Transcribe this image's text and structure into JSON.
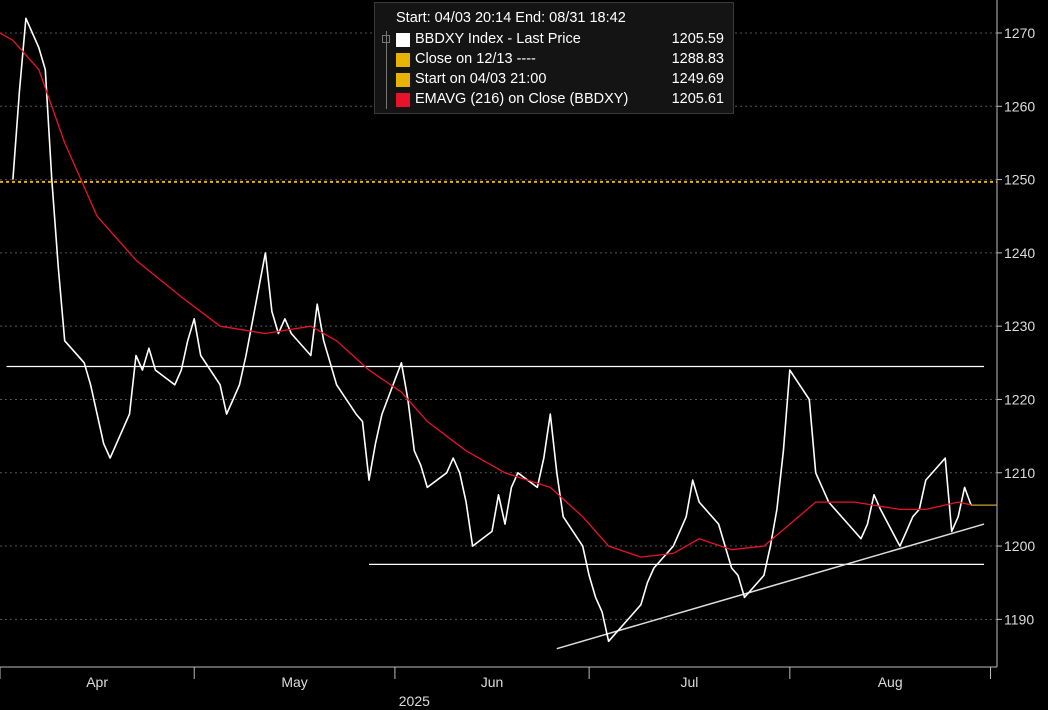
{
  "legend": {
    "header": "Start: 04/03 20:14  End: 08/31 18:42",
    "items": [
      {
        "label": "BBDXY Index - Last Price",
        "value": "1205.59",
        "color": "#ffffff"
      },
      {
        "label": "Close on 12/13 ----",
        "value": "1288.83",
        "color": "#e8b200"
      },
      {
        "label": "Start on 04/03 21:00",
        "value": "1249.69",
        "color": "#e8b200"
      },
      {
        "label": "EMAVG (216)  on Close (BBDXY)",
        "value": "1205.61",
        "color": "#e8132a"
      }
    ]
  },
  "chart_data": {
    "type": "line",
    "title": "",
    "xlabel": "2025",
    "ylabel": "",
    "x_ticks": [
      "Apr",
      "May",
      "Jun",
      "Jul",
      "Aug"
    ],
    "y_ticks": [
      1190,
      1200,
      1210,
      1220,
      1230,
      1240,
      1250,
      1260,
      1270
    ],
    "ylim": [
      1183.5,
      1274.5
    ],
    "grid": "horizontal dashed",
    "series": [
      {
        "name": "BBDXY Index - Last Price",
        "color": "#ffffff",
        "points": [
          [
            "04/03",
            1250
          ],
          [
            "04/04",
            1262
          ],
          [
            "04/05",
            1272
          ],
          [
            "04/07",
            1268
          ],
          [
            "04/08",
            1265
          ],
          [
            "04/09",
            1250
          ],
          [
            "04/10",
            1238
          ],
          [
            "04/11",
            1228
          ],
          [
            "04/14",
            1225
          ],
          [
            "04/15",
            1222
          ],
          [
            "04/16",
            1218
          ],
          [
            "04/17",
            1214
          ],
          [
            "04/18",
            1212
          ],
          [
            "04/21",
            1218
          ],
          [
            "04/22",
            1226
          ],
          [
            "04/23",
            1224
          ],
          [
            "04/24",
            1227
          ],
          [
            "04/25",
            1224
          ],
          [
            "04/28",
            1222
          ],
          [
            "04/29",
            1224
          ],
          [
            "04/30",
            1228
          ],
          [
            "05/01",
            1231
          ],
          [
            "05/02",
            1226
          ],
          [
            "05/05",
            1222
          ],
          [
            "05/06",
            1218
          ],
          [
            "05/07",
            1220
          ],
          [
            "05/08",
            1222
          ],
          [
            "05/09",
            1226
          ],
          [
            "05/12",
            1240
          ],
          [
            "05/13",
            1232
          ],
          [
            "05/14",
            1229
          ],
          [
            "05/15",
            1231
          ],
          [
            "05/16",
            1229
          ],
          [
            "05/19",
            1226
          ],
          [
            "05/20",
            1233
          ],
          [
            "05/21",
            1228
          ],
          [
            "05/22",
            1225
          ],
          [
            "05/23",
            1222
          ],
          [
            "05/26",
            1218
          ],
          [
            "05/27",
            1217
          ],
          [
            "05/28",
            1209
          ],
          [
            "05/29",
            1214
          ],
          [
            "05/30",
            1218
          ],
          [
            "06/02",
            1225
          ],
          [
            "06/03",
            1220
          ],
          [
            "06/04",
            1213
          ],
          [
            "06/05",
            1211
          ],
          [
            "06/06",
            1208
          ],
          [
            "06/09",
            1210
          ],
          [
            "06/10",
            1212
          ],
          [
            "06/11",
            1210
          ],
          [
            "06/12",
            1206
          ],
          [
            "06/13",
            1200
          ],
          [
            "06/16",
            1202
          ],
          [
            "06/17",
            1207
          ],
          [
            "06/18",
            1203
          ],
          [
            "06/19",
            1208
          ],
          [
            "06/20",
            1210
          ],
          [
            "06/23",
            1208
          ],
          [
            "06/24",
            1212
          ],
          [
            "06/25",
            1218
          ],
          [
            "06/26",
            1210
          ],
          [
            "06/27",
            1204
          ],
          [
            "06/30",
            1200
          ],
          [
            "07/01",
            1196
          ],
          [
            "07/02",
            1193
          ],
          [
            "07/03",
            1191
          ],
          [
            "07/04",
            1187
          ],
          [
            "07/07",
            1190
          ],
          [
            "07/08",
            1191
          ],
          [
            "07/09",
            1192
          ],
          [
            "07/10",
            1195
          ],
          [
            "07/11",
            1197
          ],
          [
            "07/14",
            1200
          ],
          [
            "07/15",
            1202
          ],
          [
            "07/16",
            1204
          ],
          [
            "07/17",
            1209
          ],
          [
            "07/18",
            1206
          ],
          [
            "07/21",
            1203
          ],
          [
            "07/22",
            1200
          ],
          [
            "07/23",
            1197
          ],
          [
            "07/24",
            1196
          ],
          [
            "07/25",
            1193
          ],
          [
            "07/28",
            1196
          ],
          [
            "07/29",
            1200
          ],
          [
            "07/30",
            1205
          ],
          [
            "07/31",
            1213
          ],
          [
            "08/01",
            1224
          ],
          [
            "08/04",
            1220
          ],
          [
            "08/05",
            1210
          ],
          [
            "08/06",
            1208
          ],
          [
            "08/07",
            1206
          ],
          [
            "08/08",
            1205
          ],
          [
            "08/11",
            1202
          ],
          [
            "08/12",
            1201
          ],
          [
            "08/13",
            1203
          ],
          [
            "08/14",
            1207
          ],
          [
            "08/15",
            1205
          ],
          [
            "08/18",
            1200
          ],
          [
            "08/19",
            1202
          ],
          [
            "08/20",
            1204
          ],
          [
            "08/21",
            1205
          ],
          [
            "08/22",
            1209
          ],
          [
            "08/25",
            1212
          ],
          [
            "08/26",
            1202
          ],
          [
            "08/27",
            1204
          ],
          [
            "08/28",
            1208
          ],
          [
            "08/29",
            1205.59
          ]
        ]
      },
      {
        "name": "EMAVG (216)  on Close (BBDXY)",
        "color": "#e8132a",
        "points": [
          [
            "04/01",
            1270
          ],
          [
            "04/03",
            1269
          ],
          [
            "04/07",
            1265
          ],
          [
            "04/11",
            1255
          ],
          [
            "04/16",
            1245
          ],
          [
            "04/22",
            1239
          ],
          [
            "04/29",
            1234
          ],
          [
            "05/05",
            1230
          ],
          [
            "05/12",
            1229
          ],
          [
            "05/19",
            1230
          ],
          [
            "05/23",
            1228
          ],
          [
            "05/28",
            1224
          ],
          [
            "06/02",
            1221
          ],
          [
            "06/06",
            1217
          ],
          [
            "06/12",
            1213
          ],
          [
            "06/18",
            1210
          ],
          [
            "06/25",
            1208
          ],
          [
            "06/30",
            1204
          ],
          [
            "07/04",
            1200
          ],
          [
            "07/09",
            1198.5
          ],
          [
            "07/14",
            1199
          ],
          [
            "07/18",
            1201
          ],
          [
            "07/23",
            1199.5
          ],
          [
            "07/28",
            1200
          ],
          [
            "08/01",
            1203
          ],
          [
            "08/05",
            1206
          ],
          [
            "08/11",
            1206
          ],
          [
            "08/18",
            1205
          ],
          [
            "08/22",
            1205
          ],
          [
            "08/27",
            1206
          ],
          [
            "08/29",
            1205.61
          ]
        ]
      },
      {
        "name": "Start on 04/03 21:00",
        "color": "#e8b200",
        "style": "dotted",
        "value": 1249.69
      }
    ],
    "annotations": [
      {
        "type": "hline",
        "y": 1224.5,
        "from": "04/02",
        "to": "08/31",
        "color": "#ffffff"
      },
      {
        "type": "hline",
        "y": 1197.5,
        "from": "05/28",
        "to": "08/31",
        "color": "#ffffff"
      },
      {
        "type": "trendline",
        "from": [
          "06/26",
          1186
        ],
        "to": [
          "08/31",
          1203
        ],
        "color": "#dddddd"
      },
      {
        "type": "last-value",
        "y": 1205.59,
        "color": "#c9a227"
      }
    ]
  }
}
